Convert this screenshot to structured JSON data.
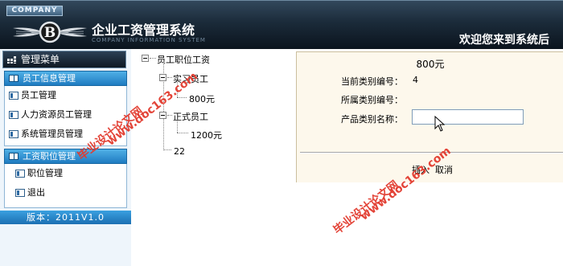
{
  "header": {
    "brand_tag": "COMPANY",
    "title": "企业工资管理系统",
    "subtitle": "COMPANY INFORMATION SYSTEM",
    "welcome": "欢迎您来到系统后"
  },
  "sidebar": {
    "menu_title": "管理菜单",
    "groups": [
      {
        "title": "员工信息管理",
        "items": [
          "员工管理",
          "人力资源员工管理",
          "系统管理员管理"
        ]
      },
      {
        "title": "工资职位管理",
        "items": [
          "职位管理",
          "退出"
        ]
      }
    ],
    "version": "版本：2011V1.0"
  },
  "tree": {
    "root": "员工职位工资",
    "nodes": [
      {
        "label": "实习员工",
        "children": [
          "800元"
        ]
      },
      {
        "label": "正式员工",
        "children": [
          "1200元"
        ]
      },
      {
        "label": "22"
      }
    ]
  },
  "form": {
    "title": "800元",
    "current_id_label": "当前类别编号：",
    "current_id_value": "4",
    "parent_id_label": "所属类别编号：",
    "parent_id_value": "",
    "name_label": "产品类别名称：",
    "name_value": "",
    "submit_label": "插入",
    "cancel_label": "取消"
  },
  "watermarks": {
    "text_cn": "毕业设计论文网",
    "text_url": "www.doc163.com"
  }
}
